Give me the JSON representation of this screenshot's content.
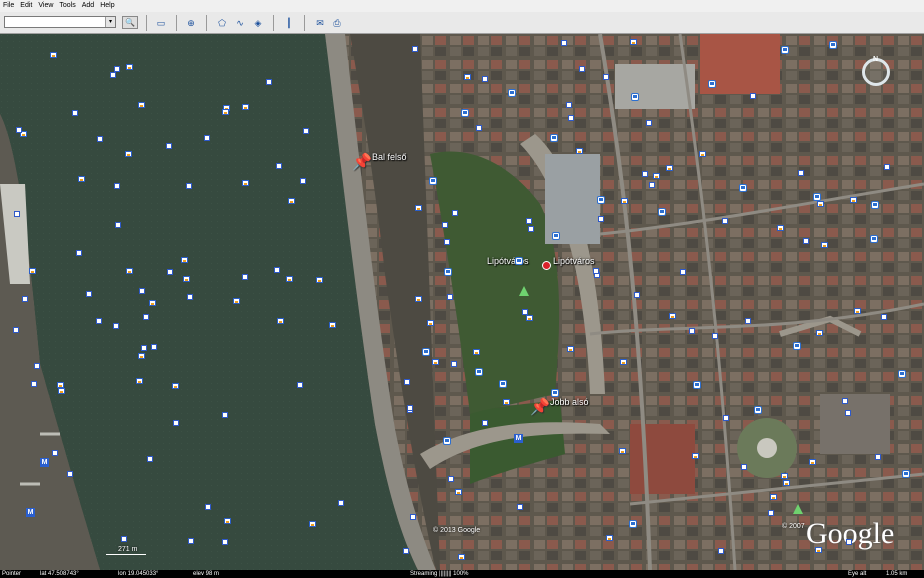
{
  "menu": [
    "File",
    "Edit",
    "View",
    "Tools",
    "Add",
    "Help"
  ],
  "search": {
    "value": "",
    "dropdown_glyph": "▾",
    "button_glyph": "🔍"
  },
  "toolbar_icons": [
    "sidebar-icon",
    "placemark-icon",
    "polygon-icon",
    "path-icon",
    "overlay-icon",
    "ruler-icon",
    "email-icon",
    "print-icon"
  ],
  "labels": {
    "bal_felso": "Bal felső",
    "lipotvaros_1": "Lipótváros",
    "lipotvaros_2": "Lipótváros",
    "jobb_also": "Jobb alsó"
  },
  "scale": "271 m",
  "copyright_2013": "© 2013 Google",
  "copyright_2007": "© 2007",
  "logo": "Google",
  "status": {
    "pointer": "Pointer",
    "lat": "lat  47.508743°",
    "lon": "lon  19.045033°",
    "elev": "elev  98 m",
    "streaming": "Streaming ||||||||  100%",
    "eye_label": "Eye alt",
    "eye_value": "1.05 km"
  },
  "colors": {
    "river": "#374a40",
    "land": "#5a5547",
    "road": "#8f8b83",
    "park": "#3f5a33",
    "roof": "#8e5148"
  }
}
